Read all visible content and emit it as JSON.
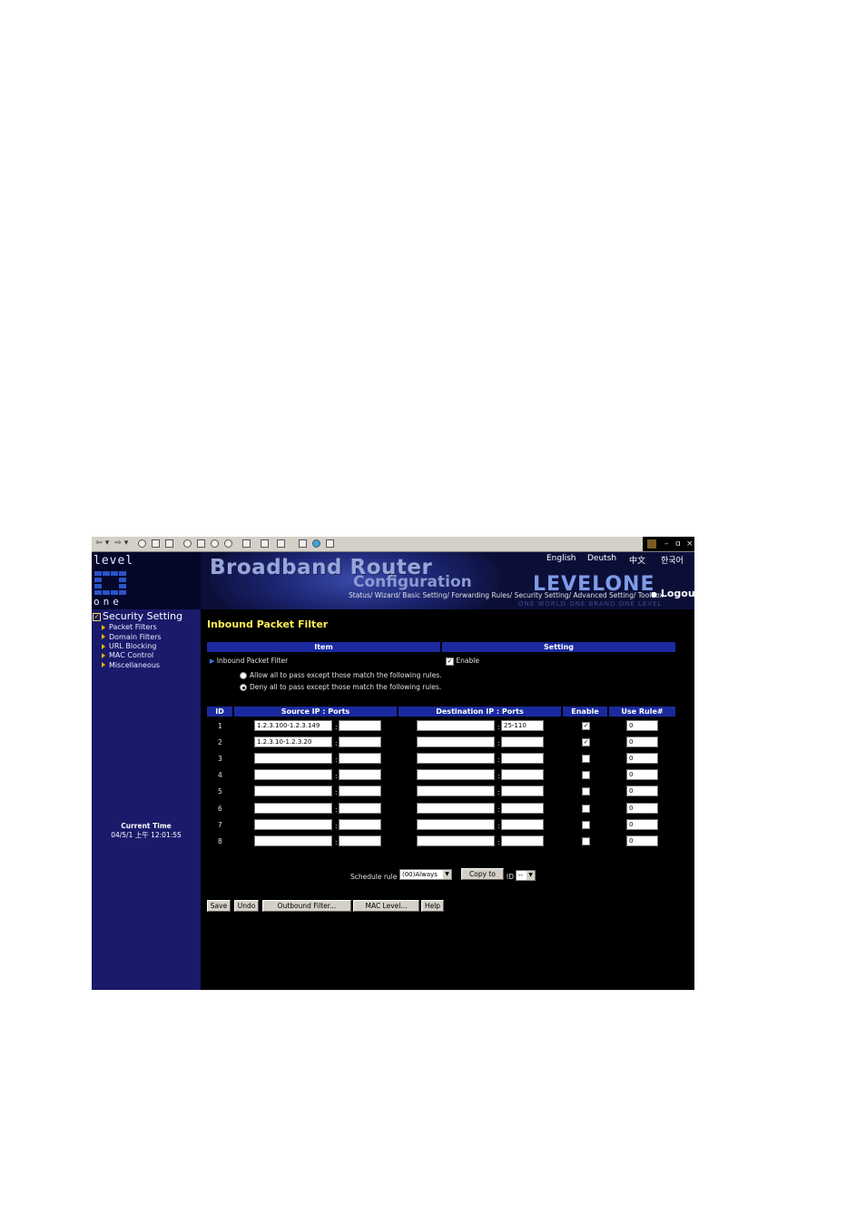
{
  "toolbar": {
    "icons": [
      "back-icon",
      "forward-icon",
      "stop-icon",
      "refresh-icon",
      "home-icon",
      "search-icon",
      "favorites-icon",
      "history-icon",
      "mail-icon",
      "print-icon",
      "edit-icon",
      "discuss-icon",
      "messenger-icon"
    ],
    "window_controls": [
      "–",
      "ɑ",
      "×"
    ]
  },
  "header": {
    "logo_top": "level",
    "logo_bottom": "one",
    "title_line1": "Broadband Router",
    "title_line2": "Configuration",
    "languages": [
      "English",
      "Deutsh",
      "中文",
      "한국어"
    ],
    "brand": "LEVELONE",
    "tagline": "ONE WORLD  ONE BRAND  ONE LEVEL",
    "nav": "Status/ Wizard/ Basic Setting/ Forwarding Rules/ Security Setting/ Advanced Setting/ Toolbox",
    "logout": "Logout"
  },
  "sidebar": {
    "section": "Security Setting",
    "items": [
      "Packet Filters",
      "Domain Filters",
      "URL Blocking",
      "MAC Control",
      "Miscellaneous"
    ],
    "current_time_label": "Current Time",
    "current_time_value": "04/5/1 上午 12:01:55"
  },
  "main": {
    "title": "Inbound Packet Filter",
    "item_header": "Item",
    "setting_header": "Setting",
    "row_label": "Inbound Packet Filter",
    "enable_label": "Enable",
    "enable_checked": true,
    "option_allow": "Allow all to pass except those match the following rules.",
    "option_deny": "Deny all to pass except those match the following rules.",
    "selected_option": "deny",
    "table": {
      "headers": [
        "ID",
        "Source IP : Ports",
        "Destination IP : Ports",
        "Enable",
        "Use Rule#"
      ],
      "rows": [
        {
          "id": "1",
          "src_ip": "1.2.3.100-1.2.3.149",
          "src_port": "",
          "dst_ip": "",
          "dst_port": "25-110",
          "enabled": true,
          "rule": "0"
        },
        {
          "id": "2",
          "src_ip": "1.2.3.10-1.2.3.20",
          "src_port": "",
          "dst_ip": "",
          "dst_port": "",
          "enabled": true,
          "rule": "0"
        },
        {
          "id": "3",
          "src_ip": "",
          "src_port": "",
          "dst_ip": "",
          "dst_port": "",
          "enabled": false,
          "rule": "0"
        },
        {
          "id": "4",
          "src_ip": "",
          "src_port": "",
          "dst_ip": "",
          "dst_port": "",
          "enabled": false,
          "rule": "0"
        },
        {
          "id": "5",
          "src_ip": "",
          "src_port": "",
          "dst_ip": "",
          "dst_port": "",
          "enabled": false,
          "rule": "0"
        },
        {
          "id": "6",
          "src_ip": "",
          "src_port": "",
          "dst_ip": "",
          "dst_port": "",
          "enabled": false,
          "rule": "0"
        },
        {
          "id": "7",
          "src_ip": "",
          "src_port": "",
          "dst_ip": "",
          "dst_port": "",
          "enabled": false,
          "rule": "0"
        },
        {
          "id": "8",
          "src_ip": "",
          "src_port": "",
          "dst_ip": "",
          "dst_port": "",
          "enabled": false,
          "rule": "0"
        }
      ]
    },
    "schedule_label": "Schedule rule",
    "schedule_value": "(00)Always",
    "copy_button": "Copy to",
    "id_label": "ID",
    "id_value": "--",
    "buttons": {
      "save": "Save",
      "undo": "Undo",
      "outbound": "Outbound Filter...",
      "mac": "MAC Level...",
      "help": "Help"
    }
  }
}
